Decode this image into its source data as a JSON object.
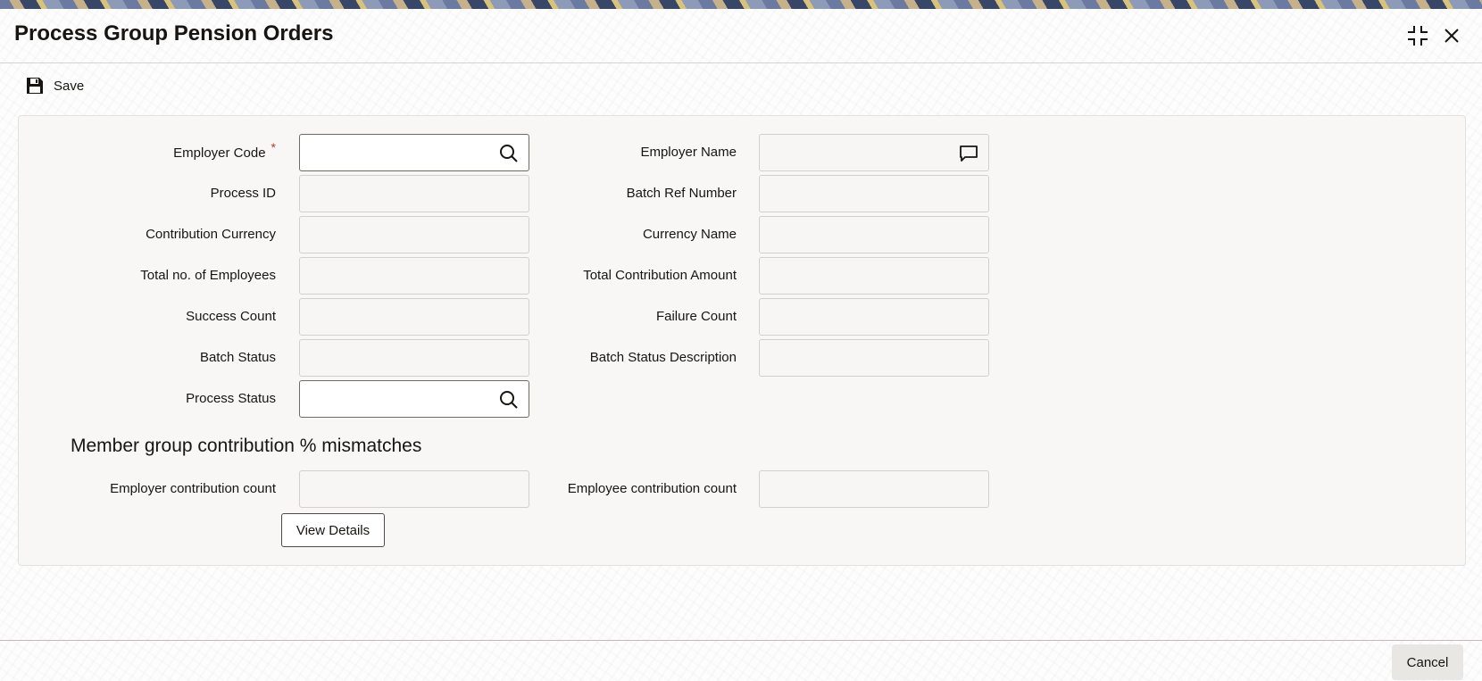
{
  "window": {
    "title": "Process Group Pension Orders"
  },
  "toolbar": {
    "save_label": "Save"
  },
  "form": {
    "employer_code": {
      "label": "Employer Code",
      "required_mark": "*",
      "value": ""
    },
    "employer_name": {
      "label": "Employer Name",
      "value": ""
    },
    "process_id": {
      "label": "Process ID",
      "value": ""
    },
    "batch_ref_number": {
      "label": "Batch Ref Number",
      "value": ""
    },
    "contribution_currency": {
      "label": "Contribution Currency",
      "value": ""
    },
    "currency_name": {
      "label": "Currency Name",
      "value": ""
    },
    "total_employees": {
      "label": "Total no. of Employees",
      "value": ""
    },
    "total_contribution_amount": {
      "label": "Total Contribution Amount",
      "value": ""
    },
    "success_count": {
      "label": "Success Count",
      "value": ""
    },
    "failure_count": {
      "label": "Failure Count",
      "value": ""
    },
    "batch_status": {
      "label": "Batch Status",
      "value": ""
    },
    "batch_status_description": {
      "label": "Batch Status Description",
      "value": ""
    },
    "process_status": {
      "label": "Process Status",
      "value": ""
    }
  },
  "mismatch_section": {
    "title": "Member group contribution % mismatches",
    "employer_contribution_count": {
      "label": "Employer contribution count",
      "value": ""
    },
    "employee_contribution_count": {
      "label": "Employee contribution count",
      "value": ""
    },
    "view_details_label": "View Details"
  },
  "footer": {
    "cancel_label": "Cancel"
  },
  "icons": {
    "save": "floppy-disk-icon",
    "search": "search-icon",
    "comment": "speech-bubble-icon",
    "restore": "restore-window-icon",
    "close": "close-icon"
  },
  "colors": {
    "required": "#c0392b",
    "panel_bg": "#f8f7f5",
    "text": "#161513"
  }
}
